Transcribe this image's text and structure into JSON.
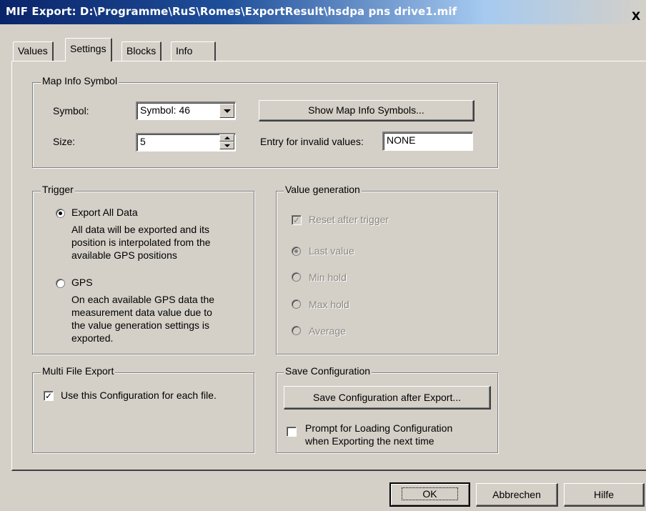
{
  "window": {
    "title": "MIF Export: D:\\Programme\\RuS\\Romes\\ExportResult\\hsdpa pns drive1.mif",
    "close_glyph": "X"
  },
  "tabs": [
    {
      "label": "Values"
    },
    {
      "label": "Settings",
      "active": true
    },
    {
      "label": "Blocks"
    },
    {
      "label": "Info"
    }
  ],
  "map_info_symbol": {
    "legend": "Map Info Symbol",
    "symbol_label": "Symbol:",
    "symbol_value": "Symbol: 46",
    "size_label": "Size:",
    "size_value": "5",
    "show_button": "Show Map Info Symbols...",
    "invalid_label": "Entry for invalid values:",
    "invalid_value": "NONE"
  },
  "trigger": {
    "legend": "Trigger",
    "export_all_label": "Export All Data",
    "export_all_selected": true,
    "export_all_desc": [
      "All data will be exported and its",
      "position is interpolated from the",
      "available GPS positions"
    ],
    "gps_label": "GPS",
    "gps_selected": false,
    "gps_desc": [
      "On each available GPS data the",
      "measurement data value due to",
      "the value generation settings is",
      "exported."
    ]
  },
  "value_generation": {
    "legend": "Value generation",
    "reset_label": "Reset after trigger",
    "reset_checked": true,
    "last_value": "Last value",
    "min_hold": "Min hold",
    "max_hold": "Max hold",
    "average": "Average",
    "selected": "Last value",
    "enabled": false
  },
  "multi_file": {
    "legend": "Multi File Export",
    "use_config_label": "Use this Configuration for each file.",
    "use_config_checked": true
  },
  "save_config": {
    "legend": "Save Configuration",
    "save_button": "Save Configuration after Export...",
    "prompt_label": [
      "Prompt for Loading Configuration",
      "when Exporting the next time"
    ],
    "prompt_checked": false
  },
  "footer": {
    "ok": "OK",
    "cancel": "Abbrechen",
    "help": "Hilfe"
  },
  "colors": {
    "titlebar_start": "#0a246a",
    "face": "#d4d0c8"
  },
  "icons": {
    "close": "close-icon",
    "dropdown": "chevron-down-icon",
    "spin": "spinner-arrows-icon"
  }
}
